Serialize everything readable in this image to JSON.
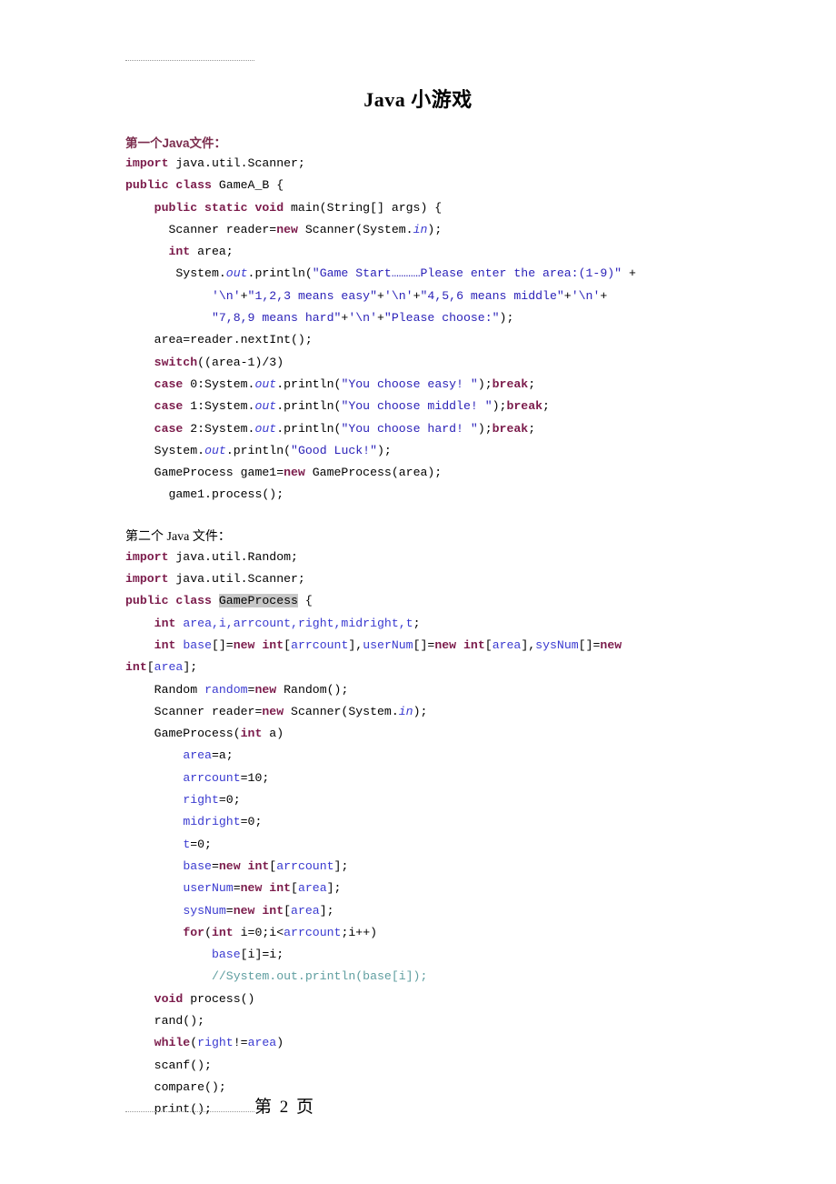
{
  "document": {
    "title": "Java 小游戏",
    "page_footer": "第 2 页",
    "sections": {
      "first_file_label": "第一个Java文件：",
      "second_file_label": "第二个 Java 文件："
    }
  },
  "code_block_1": {
    "lines": [
      "import java.util.Scanner;",
      "public class GameA_B {",
      "    public static void main(String[] args) {",
      "      Scanner reader=new Scanner(System.in);",
      "      int area;",
      "       System.out.println(\"Game Start…………Please enter the area:(1-9)\" +",
      "            '\\n'+\"1,2,3 means easy\"+'\\n'+\"4,5,6 means middle\"+'\\n'+",
      "            \"7,8,9 means hard\"+'\\n'+\"Please choose:\");",
      "    area=reader.nextInt();",
      "    switch((area-1)/3)",
      "    case 0:System.out.println(\"You choose easy! \");break;",
      "    case 1:System.out.println(\"You choose middle! \");break;",
      "    case 2:System.out.println(\"You choose hard! \");break;",
      "    System.out.println(\"Good Luck!\");",
      "    GameProcess game1=new GameProcess(area);",
      "      game1.process();"
    ]
  },
  "code_block_2": {
    "lines": [
      "import java.util.Random;",
      "import java.util.Scanner;",
      "public class GameProcess {",
      "    int area,i,arrcount,right,midright,t;",
      "    int base[]=new int[arrcount],userNum[]=new int[area],sysNum[]=new",
      "int[area];",
      "    Random random=new Random();",
      "    Scanner reader=new Scanner(System.in);",
      "    GameProcess(int a)",
      "        area=a;",
      "        arrcount=10;",
      "        right=0;",
      "        midright=0;",
      "        t=0;",
      "        base=new int[arrcount];",
      "        userNum=new int[area];",
      "        sysNum=new int[area];",
      "        for(int i=0;i<arrcount;i++)",
      "            base[i]=i;",
      "            //System.out.println(base[i]);",
      "    void process()",
      "    rand();",
      "    while(right!=area)",
      "    scanf();",
      "    compare();",
      "    print();"
    ]
  },
  "colors": {
    "keyword": "#7b1b4b",
    "string": "#2b22b8",
    "comment": "#5f9ea0",
    "variable": "#3a3ad0",
    "heading": "#7b2d4e",
    "highlight": "#c8c8c8"
  }
}
